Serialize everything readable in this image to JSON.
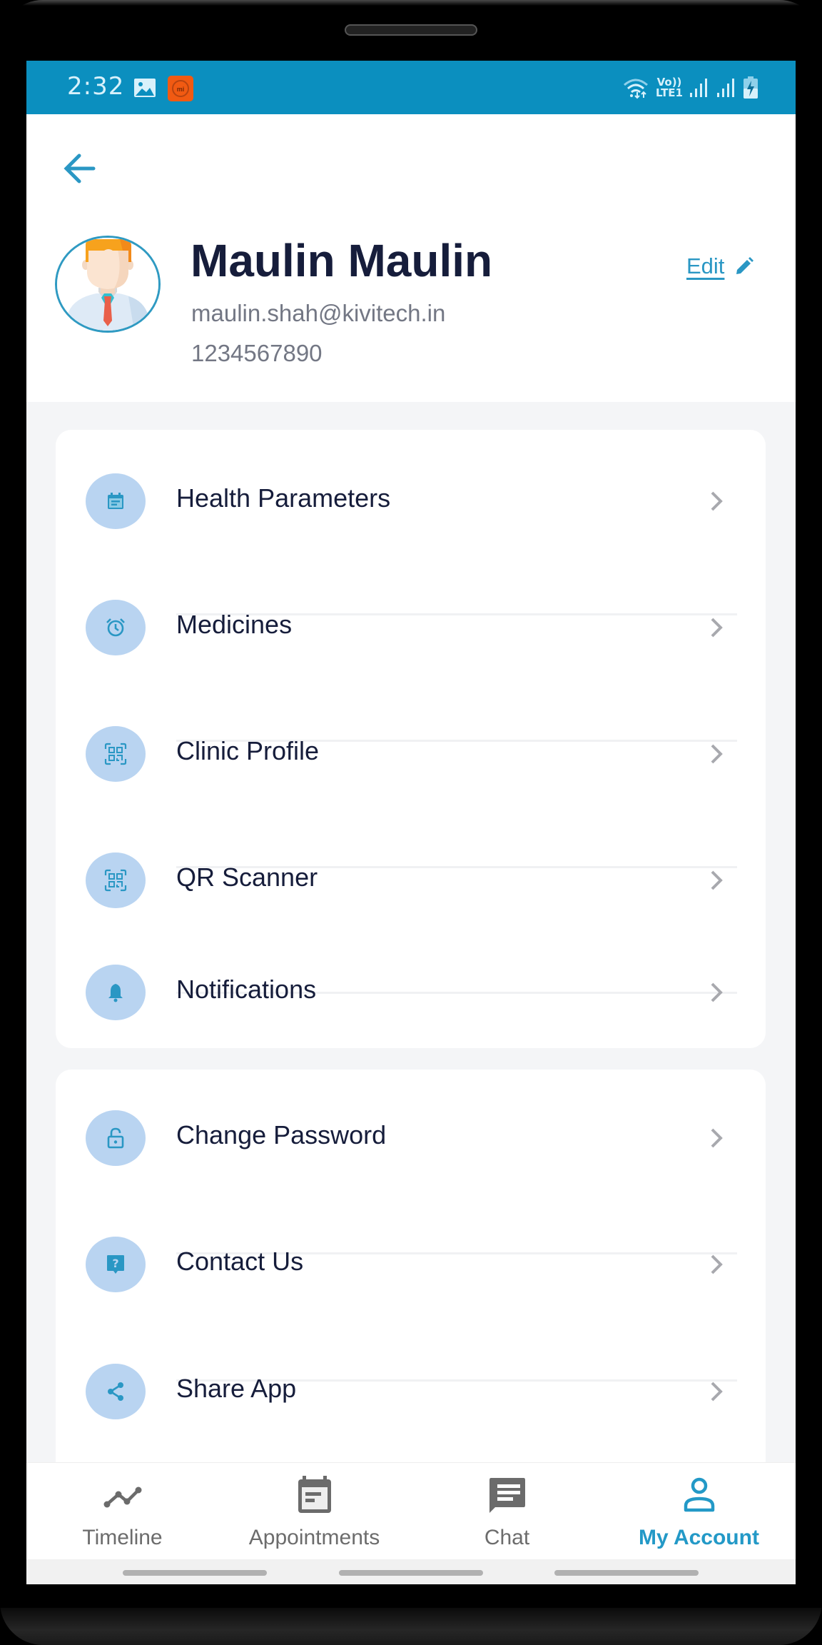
{
  "status_bar": {
    "time": "2:32",
    "network_type": "LTE1",
    "volte_label": "Vo))",
    "icons": [
      "gallery-icon",
      "mi-app-icon",
      "wifi-icon",
      "volte-icon",
      "signal-icon",
      "signal-icon",
      "battery-charging-icon"
    ]
  },
  "header": {
    "back_icon": "arrow-left-icon",
    "name": "Maulin Maulin",
    "email": "maulin.shah@kivitech.in",
    "phone": "1234567890",
    "edit_label": "Edit",
    "edit_icon": "pencil-icon"
  },
  "menu": {
    "group_1": [
      {
        "label": "Health Parameters",
        "icon": "calendar-note-icon"
      },
      {
        "label": "Medicines",
        "icon": "alarm-clock-icon"
      },
      {
        "label": "Clinic Profile",
        "icon": "qr-code-icon"
      },
      {
        "label": "QR Scanner",
        "icon": "qr-code-icon"
      },
      {
        "label": "Notifications",
        "icon": "bell-icon"
      }
    ],
    "group_2": [
      {
        "label": "Change Password",
        "icon": "unlock-icon"
      },
      {
        "label": "Contact Us",
        "icon": "help-bubble-icon"
      },
      {
        "label": "Share App",
        "icon": "share-icon"
      }
    ]
  },
  "bottom_nav": {
    "items": [
      {
        "label": "Timeline",
        "icon": "timeline-icon",
        "active": false
      },
      {
        "label": "Appointments",
        "icon": "calendar-icon",
        "active": false
      },
      {
        "label": "Chat",
        "icon": "chat-icon",
        "active": false
      },
      {
        "label": "My Account",
        "icon": "person-icon",
        "active": true
      }
    ]
  },
  "colors": {
    "status_bar": "#0b8fbf",
    "accent": "#2399c7",
    "icon_bg": "#b9d4f1",
    "text_dark": "#161d3b",
    "text_muted": "#737784",
    "page_bg": "#f4f5f7"
  }
}
